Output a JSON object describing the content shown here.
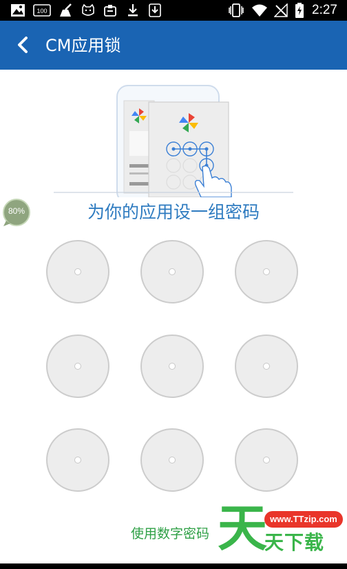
{
  "status_bar": {
    "time": "2:27",
    "notification_badge": "100",
    "icons_left": [
      "photo-icon",
      "notification-100-icon",
      "cleaner-broom-icon",
      "cat-icon",
      "clipboard-icon",
      "download-icon",
      "download-box-icon"
    ],
    "icons_right": [
      "vibrate-icon",
      "wifi-icon",
      "no-signal-icon",
      "battery-charging-icon"
    ]
  },
  "app_bar": {
    "title": "CM应用锁",
    "back_icon": "chevron-left-icon",
    "color": "#1a64b3"
  },
  "battery_bubble": {
    "percent": "80%"
  },
  "prompt": "为你的应用设一组密码",
  "pattern": {
    "rows": 3,
    "cols": 3,
    "dot_color": "#ededed"
  },
  "use_digits_label": "使用数字密码",
  "watermark": {
    "url": "www.TTzip.com",
    "big_char": "天",
    "text": "天下载"
  }
}
